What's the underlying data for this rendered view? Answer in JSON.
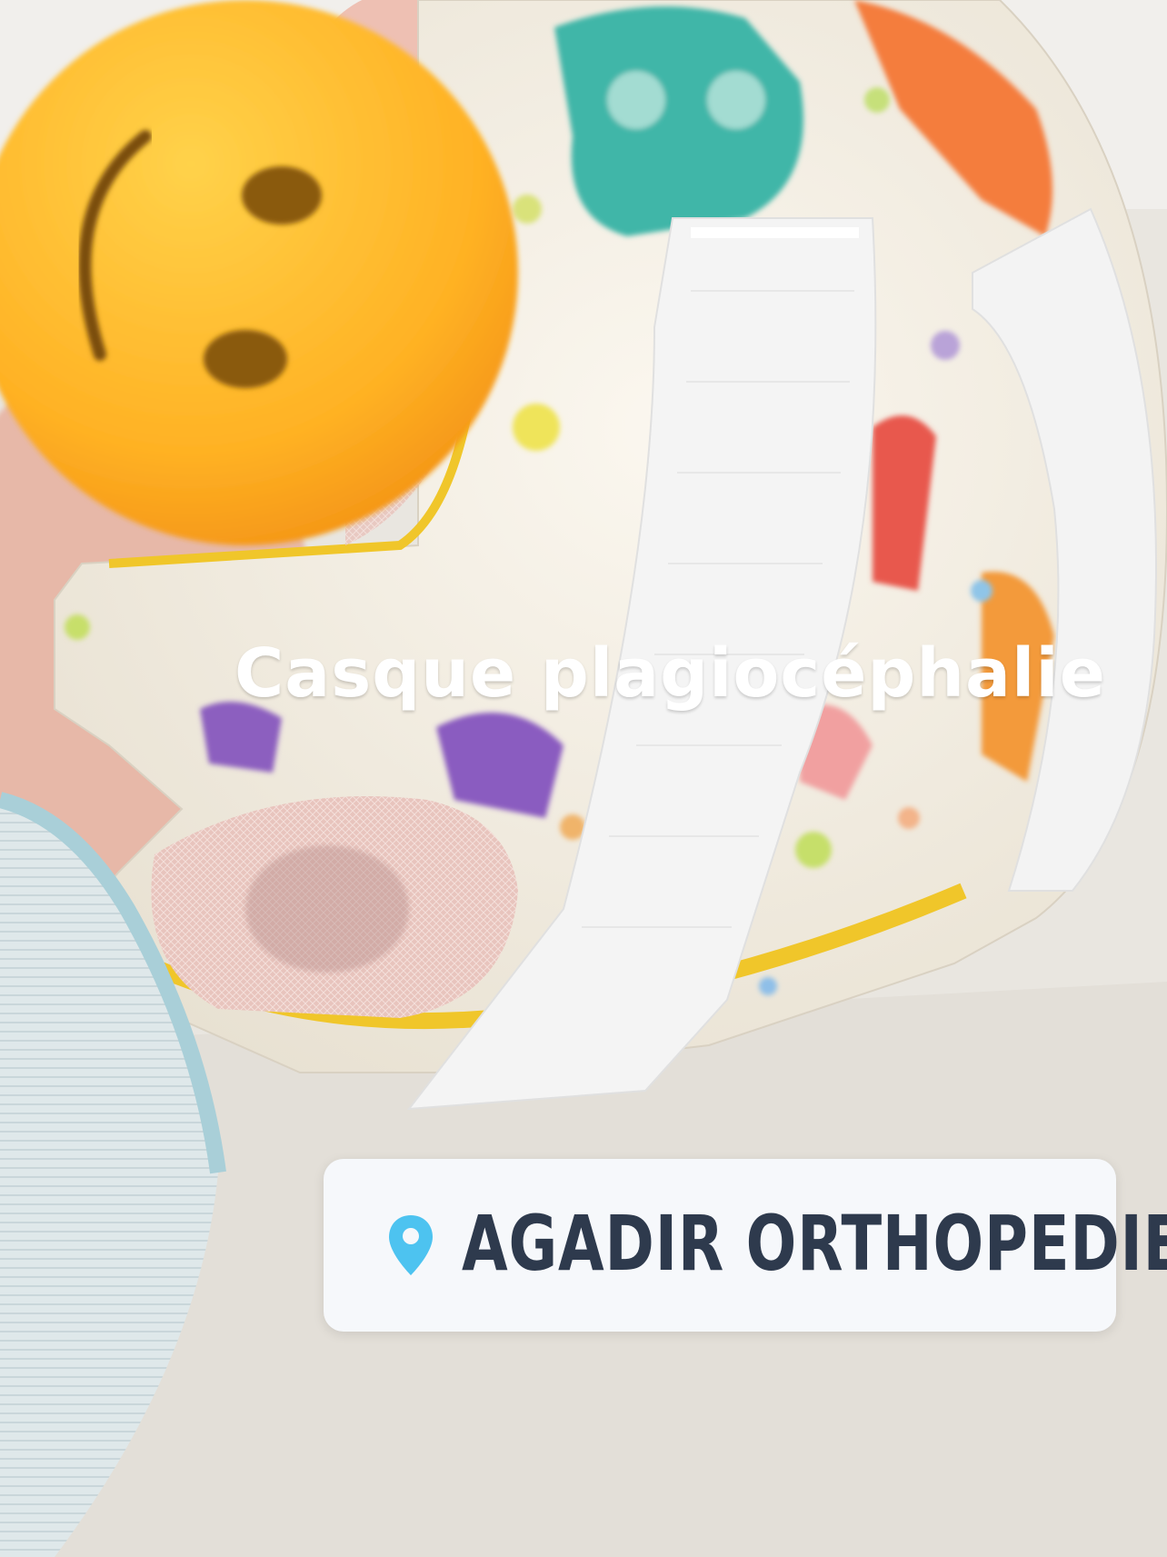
{
  "story": {
    "caption": "Casque plagiocéphalie",
    "location_sticker": {
      "label": "AGADIR ORTHOPEDIE",
      "icon": "location-pin-icon"
    }
  },
  "colors": {
    "pin": "#4dc3f0",
    "sticker_text": "#2e3a4d",
    "sticker_bg": "#f6f8fb",
    "caption": "#ffffff"
  }
}
